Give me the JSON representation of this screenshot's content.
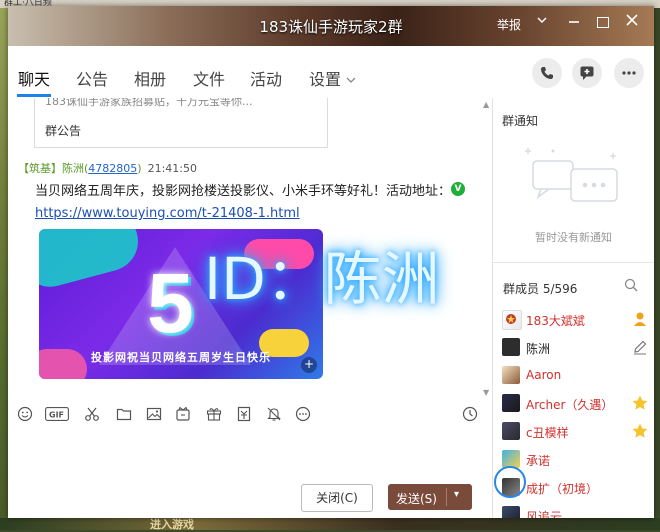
{
  "desktop": {
    "top_text": "群工·八日频",
    "bottom_text": "进入游戏"
  },
  "window": {
    "title": "183诛仙手游玩家2群",
    "report_label": "举报"
  },
  "tabs": [
    {
      "label": "聊天"
    },
    {
      "label": "公告"
    },
    {
      "label": "相册"
    },
    {
      "label": "文件"
    },
    {
      "label": "活动"
    },
    {
      "label": "设置"
    }
  ],
  "chat": {
    "notice_truncated": "183诛仙手游家族招募贴，千万元宝等你...",
    "notice_label": "群公告",
    "message": {
      "sender_tag": "【筑基】陈洲",
      "sender_id": "4782805",
      "time": "21:41:50",
      "text": "当贝网络五周年庆，投影网抢楼送投影仪、小米手环等好礼！活动地址：",
      "link": "https://www.touying.com/t-21408-1.html",
      "banner_number": "5",
      "banner_caption": "投影网祝当贝网络五周岁生日快乐"
    },
    "watermark": "ID：陈洲"
  },
  "actions": {
    "close_label": "关闭(C)",
    "send_label": "发送(S)"
  },
  "right_panel": {
    "notice_title": "群通知",
    "notice_empty": "暂时没有新通知",
    "members_title": "群成员 5/596",
    "members": [
      {
        "name": "183大斌斌",
        "color": "#d0312d",
        "role": "owner-icon"
      },
      {
        "name": "陈洲",
        "color": "#222222",
        "role": "edit-icon"
      },
      {
        "name": "Aaron",
        "color": "#d0312d",
        "role": ""
      },
      {
        "name": "Archer（久遇）",
        "color": "#d0312d",
        "role": "star-icon"
      },
      {
        "name": "c丑模样",
        "color": "#d0312d",
        "role": "star-icon"
      },
      {
        "name": "承诺",
        "color": "#d0312d",
        "role": ""
      },
      {
        "name": "成扩（初境）",
        "color": "#d0312d",
        "role": ""
      },
      {
        "name": "风追云",
        "color": "#d0312d",
        "role": ""
      }
    ]
  }
}
